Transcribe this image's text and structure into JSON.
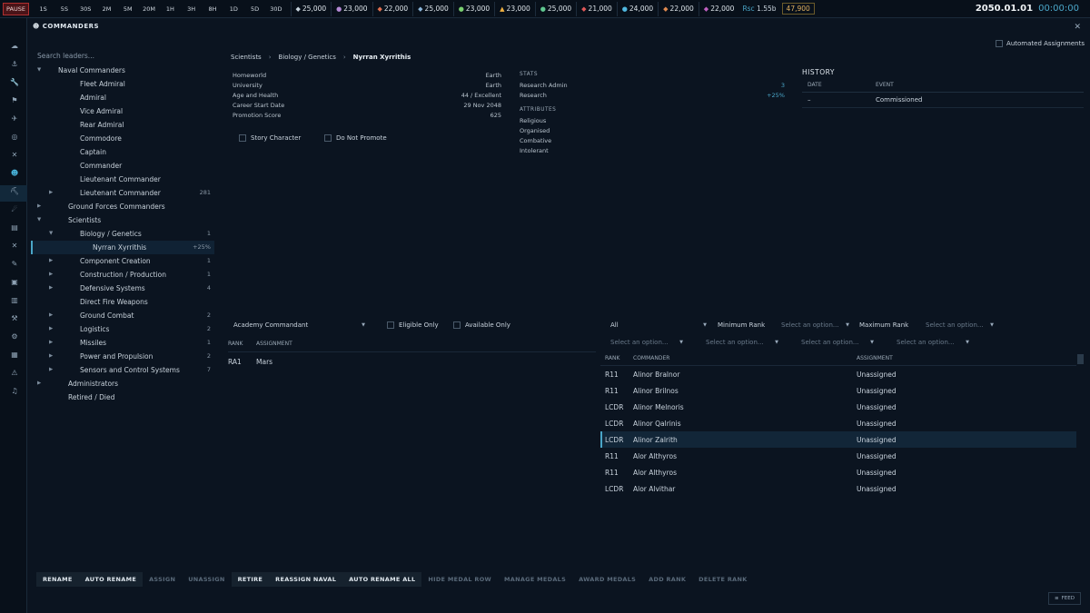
{
  "topbar": {
    "pause": "PAUSE",
    "speeds": [
      "1S",
      "5S",
      "30S",
      "2M",
      "5M",
      "20M",
      "1H",
      "3H",
      "8H",
      "1D",
      "5D",
      "30D"
    ],
    "resources": [
      {
        "icon": "duranium-icon",
        "value": "25,000",
        "color": "#c8d4de"
      },
      {
        "icon": "neutronium-icon",
        "value": "23,000",
        "color": "#b58ad6"
      },
      {
        "icon": "corbomite-icon",
        "value": "22,000",
        "color": "#e07050"
      },
      {
        "icon": "tritanium-icon",
        "value": "25,000",
        "color": "#8ab4d8"
      },
      {
        "icon": "boronide-icon",
        "value": "23,000",
        "color": "#7ad070"
      },
      {
        "icon": "mercassium-icon",
        "value": "23,000",
        "color": "#f0b040"
      },
      {
        "icon": "vendarite-icon",
        "value": "25,000",
        "color": "#60c890"
      },
      {
        "icon": "sorium-icon",
        "value": "21,000",
        "color": "#e05858"
      },
      {
        "icon": "uridium-icon",
        "value": "24,000",
        "color": "#50b8e0"
      },
      {
        "icon": "corundium-icon",
        "value": "22,000",
        "color": "#e08a50"
      },
      {
        "icon": "gallicite-icon",
        "value": "22,000",
        "color": "#c060c0"
      }
    ],
    "rp_label": "Rsc",
    "rp_value": "1.55b",
    "wealth": "47,900",
    "date": "2050.01.01",
    "time": "00:00:00"
  },
  "sidebar_icons": [
    "cloud-icon",
    "anchor-icon",
    "wrench-icon",
    "flag-icon",
    "rocket-icon",
    "target-icon",
    "swords-icon",
    "person-icon",
    "pickaxe-icon",
    "telescope-icon",
    "clipboard-icon",
    "cross-icon",
    "tag-icon",
    "box-icon",
    "document-icon",
    "hammer-icon",
    "gear-icon",
    "chart-icon",
    "warning-icon",
    "music-icon"
  ],
  "window": {
    "title": "COMMANDERS",
    "close": "✕",
    "search_placeholder": "Search leaders...",
    "auto_assign": "Automated Assignments"
  },
  "tree": [
    {
      "label": "Naval Commanders",
      "indent": 1,
      "arrow": "▼",
      "count": ""
    },
    {
      "label": "Fleet Admiral",
      "indent": 3,
      "arrow": "",
      "count": ""
    },
    {
      "label": "Admiral",
      "indent": 3,
      "arrow": "",
      "count": ""
    },
    {
      "label": "Vice Admiral",
      "indent": 3,
      "arrow": "",
      "count": ""
    },
    {
      "label": "Rear Admiral",
      "indent": 3,
      "arrow": "",
      "count": ""
    },
    {
      "label": "Commodore",
      "indent": 3,
      "arrow": "",
      "count": ""
    },
    {
      "label": "Captain",
      "indent": 3,
      "arrow": "",
      "count": ""
    },
    {
      "label": "Commander",
      "indent": 3,
      "arrow": "",
      "count": ""
    },
    {
      "label": "Lieutenant Commander",
      "indent": 3,
      "arrow": "",
      "count": ""
    },
    {
      "label": "Lieutenant Commander",
      "indent": 3,
      "arrow": "▶",
      "count": "281"
    },
    {
      "label": "Ground Forces Commanders",
      "indent": 2,
      "arrow": "▶",
      "count": ""
    },
    {
      "label": "Scientists",
      "indent": 2,
      "arrow": "▼",
      "count": ""
    },
    {
      "label": "Biology / Genetics",
      "indent": 3,
      "arrow": "▼",
      "count": "1"
    },
    {
      "label": "Nyrran Xyrrithis",
      "indent": 4,
      "arrow": "",
      "count": "+25%",
      "selected": true
    },
    {
      "label": "Component Creation",
      "indent": 3,
      "arrow": "▶",
      "count": "1"
    },
    {
      "label": "Construction / Production",
      "indent": 3,
      "arrow": "▶",
      "count": "1"
    },
    {
      "label": "Defensive Systems",
      "indent": 3,
      "arrow": "▶",
      "count": "4"
    },
    {
      "label": "Direct Fire Weapons",
      "indent": 3,
      "arrow": "",
      "count": ""
    },
    {
      "label": "Ground Combat",
      "indent": 3,
      "arrow": "▶",
      "count": "2"
    },
    {
      "label": "Logistics",
      "indent": 3,
      "arrow": "▶",
      "count": "2"
    },
    {
      "label": "Missiles",
      "indent": 3,
      "arrow": "▶",
      "count": "1"
    },
    {
      "label": "Power and Propulsion",
      "indent": 3,
      "arrow": "▶",
      "count": "2"
    },
    {
      "label": "Sensors and Control Systems",
      "indent": 3,
      "arrow": "▶",
      "count": "7"
    },
    {
      "label": "Administrators",
      "indent": 2,
      "arrow": "▶",
      "count": ""
    },
    {
      "label": "Retired / Died",
      "indent": 2,
      "arrow": "",
      "count": ""
    }
  ],
  "breadcrumb": {
    "a": "Scientists",
    "b": "Biology / Genetics",
    "c": "Nyrran Xyrrithis",
    "sep": "›"
  },
  "details": [
    {
      "label": "Homeworld",
      "value": "Earth"
    },
    {
      "label": "University",
      "value": "Earth"
    },
    {
      "label": "Age and Health",
      "value": "44 / Excellent"
    },
    {
      "label": "Career Start Date",
      "value": "29 Nov 2048"
    },
    {
      "label": "Promotion Score",
      "value": "625"
    }
  ],
  "checks": {
    "story": "Story Character",
    "nopromote": "Do Not Promote"
  },
  "stats": {
    "heading": "STATS",
    "rows": [
      {
        "label": "Research Admin",
        "value": "3"
      },
      {
        "label": "Research",
        "value": "+25%"
      }
    ],
    "attr_heading": "ATTRIBUTES",
    "attributes": [
      "Religious",
      "Organised",
      "Combative",
      "Intolerant"
    ]
  },
  "history": {
    "title": "HISTORY",
    "col_date": "DATE",
    "col_event": "EVENT",
    "rows": [
      {
        "date": "–",
        "event": "Commissioned"
      }
    ]
  },
  "assign_filters": {
    "type": "Academy Commandant",
    "eligible": "Eligible Only",
    "available": "Available Only"
  },
  "assignments": {
    "col_rank": "RANK",
    "col_assign": "ASSIGNMENT",
    "rows": [
      {
        "rank": "RA1",
        "assignment": "Mars"
      }
    ]
  },
  "cmd_filters": {
    "all": "All",
    "min_rank": "Minimum Rank",
    "max_rank": "Maximum Rank",
    "placeholder": "Select an option..."
  },
  "commanders": {
    "col_rank": "RANK",
    "col_name": "COMMANDER",
    "col_assign": "ASSIGNMENT",
    "rows": [
      {
        "rank": "R11",
        "name": "Alinor Bralnor",
        "assignment": "Unassigned"
      },
      {
        "rank": "R11",
        "name": "Alinor Brilnos",
        "assignment": "Unassigned"
      },
      {
        "rank": "LCDR",
        "name": "Alinor Melnoris",
        "assignment": "Unassigned"
      },
      {
        "rank": "LCDR",
        "name": "Alinor Qalrinis",
        "assignment": "Unassigned"
      },
      {
        "rank": "LCDR",
        "name": "Alinor Zalrith",
        "assignment": "Unassigned",
        "selected": true
      },
      {
        "rank": "R11",
        "name": "Alor Althyros",
        "assignment": "Unassigned"
      },
      {
        "rank": "R11",
        "name": "Alor Althyros",
        "assignment": "Unassigned"
      },
      {
        "rank": "LCDR",
        "name": "Alor Alvithar",
        "assignment": "Unassigned"
      }
    ]
  },
  "actions": [
    {
      "label": "RENAME",
      "enabled": true
    },
    {
      "label": "AUTO RENAME",
      "enabled": true
    },
    {
      "label": "ASSIGN",
      "enabled": false
    },
    {
      "label": "UNASSIGN",
      "enabled": false
    },
    {
      "label": "RETIRE",
      "enabled": true
    },
    {
      "label": "REASSIGN NAVAL",
      "enabled": true
    },
    {
      "label": "AUTO RENAME ALL",
      "enabled": true
    },
    {
      "label": "HIDE MEDAL ROW",
      "enabled": false
    },
    {
      "label": "MANAGE MEDALS",
      "enabled": false
    },
    {
      "label": "AWARD MEDALS",
      "enabled": false
    },
    {
      "label": "ADD RANK",
      "enabled": false
    },
    {
      "label": "DELETE RANK",
      "enabled": false
    }
  ],
  "feed": "FEED"
}
